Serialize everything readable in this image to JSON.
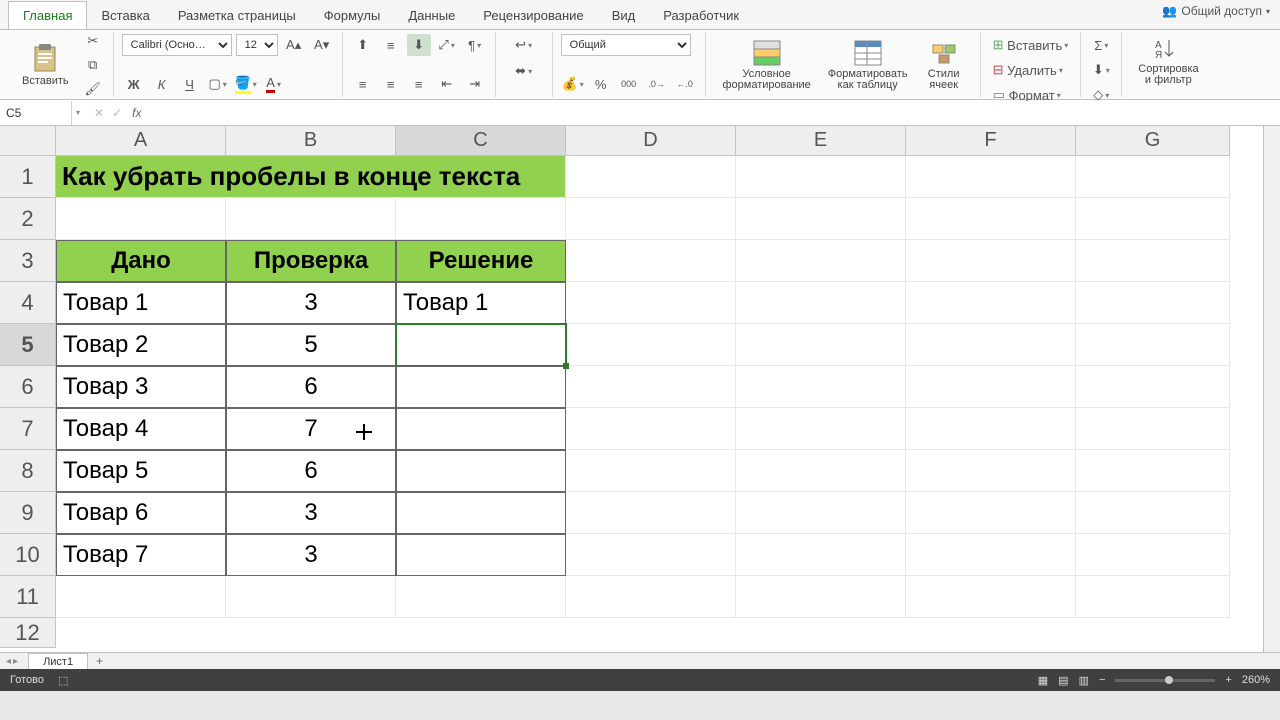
{
  "tabs": [
    "Главная",
    "Вставка",
    "Разметка страницы",
    "Формулы",
    "Данные",
    "Рецензирование",
    "Вид",
    "Разработчик"
  ],
  "activeTab": 0,
  "share": "Общий доступ",
  "ribbon": {
    "paste": "Вставить",
    "font": "Calibri (Осно…",
    "size": "12",
    "numberFormat": "Общий",
    "condFormat": "Условное форматирование",
    "formatTable": "Форматировать как таблицу",
    "cellStyles": "Стили ячеек",
    "insert": "Вставить",
    "delete": "Удалить",
    "formatBtn": "Формат",
    "sortFilter": "Сортировка и фильтр"
  },
  "nameBox": "C5",
  "columns": [
    "A",
    "B",
    "C",
    "D",
    "E",
    "F",
    "G"
  ],
  "rows": [
    "1",
    "2",
    "3",
    "4",
    "5",
    "6",
    "7",
    "8",
    "9",
    "10",
    "11",
    "12"
  ],
  "selectedRow": 4,
  "selectedCol": 2,
  "title": "Как убрать пробелы в конце текста",
  "table": {
    "headers": [
      "Дано",
      "Проверка",
      "Решение"
    ],
    "rows": [
      {
        "a": "Товар 1",
        "b": "3",
        "c": "Товар 1"
      },
      {
        "a": "Товар 2",
        "b": "5",
        "c": ""
      },
      {
        "a": "Товар 3",
        "b": "6",
        "c": ""
      },
      {
        "a": "Товар 4",
        "b": "7",
        "c": ""
      },
      {
        "a": "Товар 5",
        "b": "6",
        "c": ""
      },
      {
        "a": "Товар 6",
        "b": "3",
        "c": ""
      },
      {
        "a": "Товар 7",
        "b": "3",
        "c": ""
      }
    ]
  },
  "sheet": "Лист1",
  "status": "Готово",
  "zoom": "260%"
}
